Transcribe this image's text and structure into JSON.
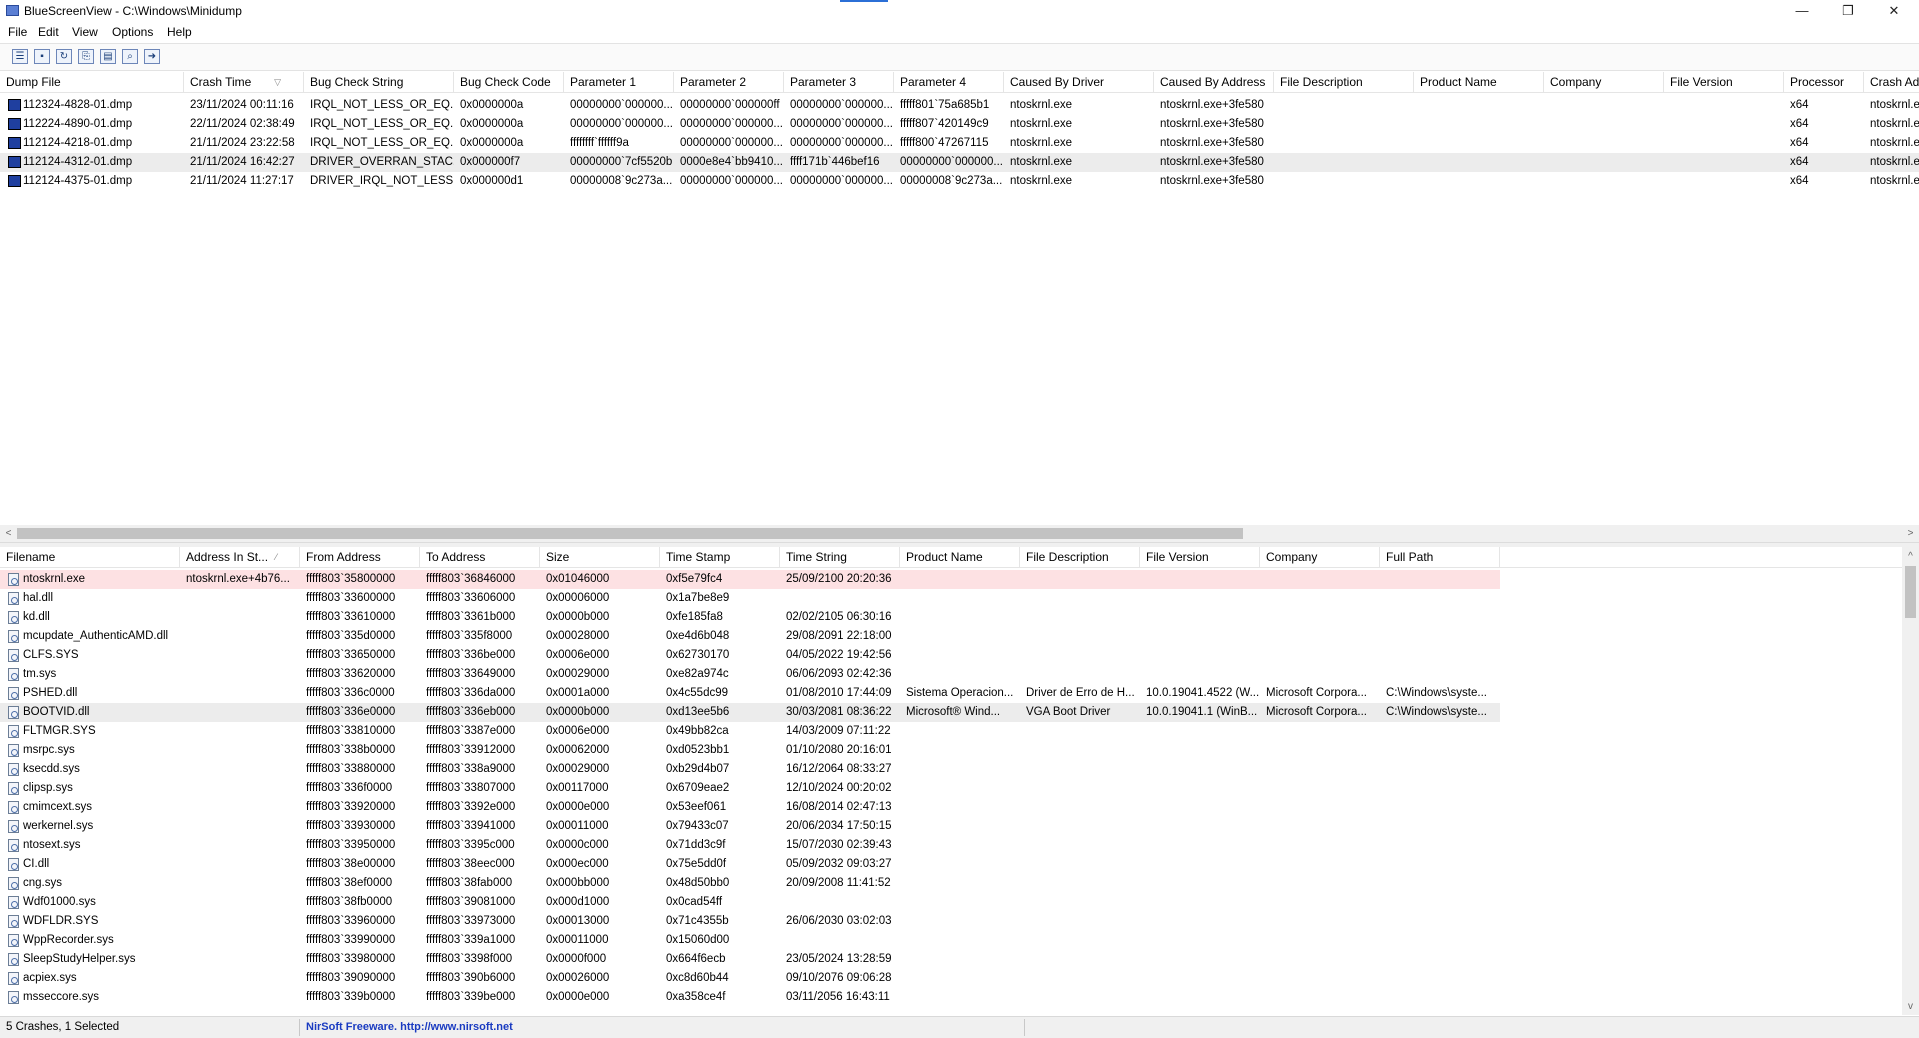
{
  "window": {
    "title": "BlueScreenView  -  C:\\Windows\\Minidump",
    "minimize": "—",
    "restore": "❐",
    "close": "✕"
  },
  "menu": [
    "File",
    "Edit",
    "View",
    "Options",
    "Help"
  ],
  "toolbar": [
    {
      "name": "properties-icon",
      "glyph": "☰"
    },
    {
      "name": "save-icon",
      "glyph": "▪"
    },
    {
      "name": "refresh-icon",
      "glyph": "↻"
    },
    {
      "name": "copy-icon",
      "glyph": "⎘"
    },
    {
      "name": "html-report-icon",
      "glyph": "▤"
    },
    {
      "name": "find-icon",
      "glyph": "⌕"
    },
    {
      "name": "exit-icon",
      "glyph": "➜"
    }
  ],
  "upper": {
    "columns": [
      {
        "label": "Dump File",
        "w": 184
      },
      {
        "label": "Crash Time",
        "w": 120,
        "sort": "▽"
      },
      {
        "label": "Bug Check String",
        "w": 150
      },
      {
        "label": "Bug Check Code",
        "w": 110
      },
      {
        "label": "Parameter 1",
        "w": 110
      },
      {
        "label": "Parameter 2",
        "w": 110
      },
      {
        "label": "Parameter 3",
        "w": 110
      },
      {
        "label": "Parameter 4",
        "w": 110
      },
      {
        "label": "Caused By Driver",
        "w": 150
      },
      {
        "label": "Caused By Address",
        "w": 120
      },
      {
        "label": "File Description",
        "w": 140
      },
      {
        "label": "Product Name",
        "w": 130
      },
      {
        "label": "Company",
        "w": 120
      },
      {
        "label": "File Version",
        "w": 120
      },
      {
        "label": "Processor",
        "w": 80
      },
      {
        "label": "Crash Add",
        "w": 70
      }
    ],
    "rows": [
      [
        "112324-4828-01.dmp",
        "23/11/2024 00:11:16",
        "IRQL_NOT_LESS_OR_EQ...",
        "0x0000000a",
        "00000000`000000...",
        "00000000`000000ff",
        "00000000`000000...",
        "fffff801`75a685b1",
        "ntoskrnl.exe",
        "ntoskrnl.exe+3fe580",
        "",
        "",
        "",
        "",
        "x64",
        "ntoskrnl.e"
      ],
      [
        "112224-4890-01.dmp",
        "22/11/2024 02:38:49",
        "IRQL_NOT_LESS_OR_EQ...",
        "0x0000000a",
        "00000000`000000...",
        "00000000`000000...",
        "00000000`000000...",
        "fffff807`420149c9",
        "ntoskrnl.exe",
        "ntoskrnl.exe+3fe580",
        "",
        "",
        "",
        "",
        "x64",
        "ntoskrnl.e"
      ],
      [
        "112124-4218-01.dmp",
        "21/11/2024 23:22:58",
        "IRQL_NOT_LESS_OR_EQ...",
        "0x0000000a",
        "ffffffff`ffffff9a",
        "00000000`000000...",
        "00000000`000000...",
        "fffff800`47267115",
        "ntoskrnl.exe",
        "ntoskrnl.exe+3fe580",
        "",
        "",
        "",
        "",
        "x64",
        "ntoskrnl.e"
      ],
      [
        "112124-4312-01.dmp",
        "21/11/2024 16:42:27",
        "DRIVER_OVERRAN_STAC...",
        "0x000000f7",
        "00000000`7cf5520b",
        "0000e8e4`bb9410...",
        "ffff171b`446bef16",
        "00000000`000000...",
        "ntoskrnl.exe",
        "ntoskrnl.exe+3fe580",
        "",
        "",
        "",
        "",
        "x64",
        "ntoskrnl.e"
      ],
      [
        "112124-4375-01.dmp",
        "21/11/2024 11:27:17",
        "DRIVER_IRQL_NOT_LESS...",
        "0x000000d1",
        "00000008`9c273a...",
        "00000000`000000...",
        "00000000`000000...",
        "00000008`9c273a...",
        "ntoskrnl.exe",
        "ntoskrnl.exe+3fe580",
        "",
        "",
        "",
        "",
        "x64",
        "ntoskrnl.e"
      ]
    ],
    "selected_row": 3
  },
  "lower": {
    "columns": [
      {
        "label": "Filename",
        "w": 180
      },
      {
        "label": "Address In St...",
        "w": 120,
        "sort": "⁄"
      },
      {
        "label": "From Address",
        "w": 120
      },
      {
        "label": "To Address",
        "w": 120
      },
      {
        "label": "Size",
        "w": 120
      },
      {
        "label": "Time Stamp",
        "w": 120
      },
      {
        "label": "Time String",
        "w": 120
      },
      {
        "label": "Product Name",
        "w": 120
      },
      {
        "label": "File Description",
        "w": 120
      },
      {
        "label": "File Version",
        "w": 120
      },
      {
        "label": "Company",
        "w": 120
      },
      {
        "label": "Full Path",
        "w": 120
      }
    ],
    "rows": [
      [
        "ntoskrnl.exe",
        "ntoskrnl.exe+4b76...",
        "fffff803`35800000",
        "fffff803`36846000",
        "0x01046000",
        "0xf5e79fc4",
        "25/09/2100 20:20:36",
        "",
        "",
        "",
        "",
        ""
      ],
      [
        "hal.dll",
        "",
        "fffff803`33600000",
        "fffff803`33606000",
        "0x00006000",
        "0x1a7be8e9",
        "",
        "",
        "",
        "",
        "",
        ""
      ],
      [
        "kd.dll",
        "",
        "fffff803`33610000",
        "fffff803`3361b000",
        "0x0000b000",
        "0xfe185fa8",
        "02/02/2105 06:30:16",
        "",
        "",
        "",
        "",
        ""
      ],
      [
        "mcupdate_AuthenticAMD.dll",
        "",
        "fffff803`335d0000",
        "fffff803`335f8000",
        "0x00028000",
        "0xe4d6b048",
        "29/08/2091 22:18:00",
        "",
        "",
        "",
        "",
        ""
      ],
      [
        "CLFS.SYS",
        "",
        "fffff803`33650000",
        "fffff803`336be000",
        "0x0006e000",
        "0x62730170",
        "04/05/2022 19:42:56",
        "",
        "",
        "",
        "",
        ""
      ],
      [
        "tm.sys",
        "",
        "fffff803`33620000",
        "fffff803`33649000",
        "0x00029000",
        "0xe82a974c",
        "06/06/2093 02:42:36",
        "",
        "",
        "",
        "",
        ""
      ],
      [
        "PSHED.dll",
        "",
        "fffff803`336c0000",
        "fffff803`336da000",
        "0x0001a000",
        "0x4c55dc99",
        "01/08/2010 17:44:09",
        "Sistema Operacion...",
        "Driver de Erro de H...",
        "10.0.19041.4522 (W...",
        "Microsoft Corpora...",
        "C:\\Windows\\syste..."
      ],
      [
        "BOOTVID.dll",
        "",
        "fffff803`336e0000",
        "fffff803`336eb000",
        "0x0000b000",
        "0xd13ee5b6",
        "30/03/2081 08:36:22",
        "Microsoft® Wind...",
        "VGA Boot Driver",
        "10.0.19041.1 (WinB...",
        "Microsoft Corpora...",
        "C:\\Windows\\syste..."
      ],
      [
        "FLTMGR.SYS",
        "",
        "fffff803`33810000",
        "fffff803`3387e000",
        "0x0006e000",
        "0x49bb82ca",
        "14/03/2009 07:11:22",
        "",
        "",
        "",
        "",
        ""
      ],
      [
        "msrpc.sys",
        "",
        "fffff803`338b0000",
        "fffff803`33912000",
        "0x00062000",
        "0xd0523bb1",
        "01/10/2080 20:16:01",
        "",
        "",
        "",
        "",
        ""
      ],
      [
        "ksecdd.sys",
        "",
        "fffff803`33880000",
        "fffff803`338a9000",
        "0x00029000",
        "0xb29d4b07",
        "16/12/2064 08:33:27",
        "",
        "",
        "",
        "",
        ""
      ],
      [
        "clipsp.sys",
        "",
        "fffff803`336f0000",
        "fffff803`33807000",
        "0x00117000",
        "0x6709eae2",
        "12/10/2024 00:20:02",
        "",
        "",
        "",
        "",
        ""
      ],
      [
        "cmimcext.sys",
        "",
        "fffff803`33920000",
        "fffff803`3392e000",
        "0x0000e000",
        "0x53eef061",
        "16/08/2014 02:47:13",
        "",
        "",
        "",
        "",
        ""
      ],
      [
        "werkernel.sys",
        "",
        "fffff803`33930000",
        "fffff803`33941000",
        "0x00011000",
        "0x79433c07",
        "20/06/2034 17:50:15",
        "",
        "",
        "",
        "",
        ""
      ],
      [
        "ntosext.sys",
        "",
        "fffff803`33950000",
        "fffff803`3395c000",
        "0x0000c000",
        "0x71dd3c9f",
        "15/07/2030 02:39:43",
        "",
        "",
        "",
        "",
        ""
      ],
      [
        "CI.dll",
        "",
        "fffff803`38e00000",
        "fffff803`38eec000",
        "0x000ec000",
        "0x75e5dd0f",
        "05/09/2032 09:03:27",
        "",
        "",
        "",
        "",
        ""
      ],
      [
        "cng.sys",
        "",
        "fffff803`38ef0000",
        "fffff803`38fab000",
        "0x000bb000",
        "0x48d50bb0",
        "20/09/2008 11:41:52",
        "",
        "",
        "",
        "",
        ""
      ],
      [
        "Wdf01000.sys",
        "",
        "fffff803`38fb0000",
        "fffff803`39081000",
        "0x000d1000",
        "0x0cad54ff",
        "",
        "",
        "",
        "",
        "",
        ""
      ],
      [
        "WDFLDR.SYS",
        "",
        "fffff803`33960000",
        "fffff803`33973000",
        "0x00013000",
        "0x71c4355b",
        "26/06/2030 03:02:03",
        "",
        "",
        "",
        "",
        ""
      ],
      [
        "WppRecorder.sys",
        "",
        "fffff803`33990000",
        "fffff803`339a1000",
        "0x00011000",
        "0x15060d00",
        "",
        "",
        "",
        "",
        "",
        ""
      ],
      [
        "SleepStudyHelper.sys",
        "",
        "fffff803`33980000",
        "fffff803`3398f000",
        "0x0000f000",
        "0x664f6ecb",
        "23/05/2024 13:28:59",
        "",
        "",
        "",
        "",
        ""
      ],
      [
        "acpiex.sys",
        "",
        "fffff803`39090000",
        "fffff803`390b6000",
        "0x00026000",
        "0xc8d60b44",
        "09/10/2076 09:06:28",
        "",
        "",
        "",
        "",
        ""
      ],
      [
        "msseccore.sys",
        "",
        "fffff803`339b0000",
        "fffff803`339be000",
        "0x0000e000",
        "0xa358ce4f",
        "03/11/2056 16:43:11",
        "",
        "",
        "",
        "",
        ""
      ]
    ],
    "pink_row": 0,
    "gray_row": 7,
    "highlight_width": 1500
  },
  "scroll": {
    "left": "<",
    "right": ">",
    "up": "^",
    "down": "v"
  },
  "status": {
    "crashes": "5 Crashes, 1 Selected",
    "freeware": "NirSoft Freeware.  http://www.nirsoft.net"
  }
}
